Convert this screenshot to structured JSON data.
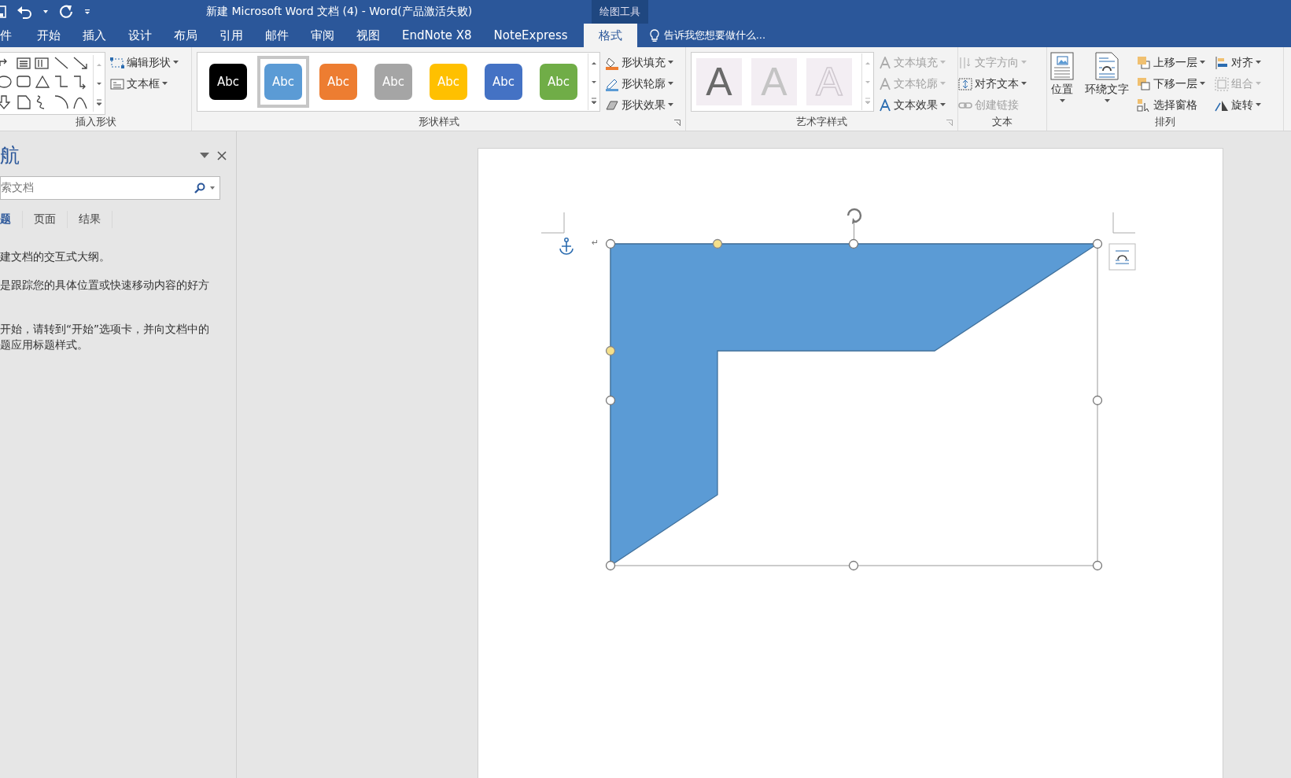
{
  "title_bar": {
    "title": "新建 Microsoft Word 文档 (4) - Word(产品激活失败)",
    "context_label": "绘图工具"
  },
  "tabs": [
    {
      "label": "件",
      "selected": false
    },
    {
      "label": "开始",
      "selected": false
    },
    {
      "label": "插入",
      "selected": false
    },
    {
      "label": "设计",
      "selected": false
    },
    {
      "label": "布局",
      "selected": false
    },
    {
      "label": "引用",
      "selected": false
    },
    {
      "label": "邮件",
      "selected": false
    },
    {
      "label": "审阅",
      "selected": false
    },
    {
      "label": "视图",
      "selected": false
    },
    {
      "label": "EndNote X8",
      "selected": false
    },
    {
      "label": "NoteExpress",
      "selected": false
    },
    {
      "label": "格式",
      "selected": true
    }
  ],
  "tell_me": {
    "placeholder": "告诉我您想要做什么..."
  },
  "ribbon": {
    "insert_shapes": {
      "label": "插入形状",
      "commands": [
        {
          "label": "编辑形状",
          "menu": true
        },
        {
          "label": "文本框",
          "menu": true
        }
      ]
    },
    "shape_styles": {
      "label": "形状样式",
      "presets": [
        {
          "label": "Abc",
          "color": "#000000",
          "selected": false
        },
        {
          "label": "Abc",
          "color": "#5b9bd5",
          "selected": true
        },
        {
          "label": "Abc",
          "color": "#ed7d31",
          "selected": false
        },
        {
          "label": "Abc",
          "color": "#a5a5a5",
          "selected": false
        },
        {
          "label": "Abc",
          "color": "#ffc000",
          "selected": false
        },
        {
          "label": "Abc",
          "color": "#4472c4",
          "selected": false
        },
        {
          "label": "Abc",
          "color": "#70ad47",
          "selected": false
        }
      ],
      "commands": [
        {
          "label": "形状填充",
          "menu": true
        },
        {
          "label": "形状轮廓",
          "menu": true
        },
        {
          "label": "形状效果",
          "menu": true
        }
      ]
    },
    "wordart_styles": {
      "label": "艺术字样式",
      "presets": [
        {
          "label": "A",
          "kind": "dark"
        },
        {
          "label": "A",
          "kind": "light"
        },
        {
          "label": "A",
          "kind": "outline"
        }
      ],
      "commands": [
        {
          "label": "文本填充",
          "menu": true,
          "disabled": true
        },
        {
          "label": "文本轮廓",
          "menu": true,
          "disabled": true
        },
        {
          "label": "文本效果",
          "menu": true,
          "disabled": false
        }
      ]
    },
    "text": {
      "label": "文本",
      "commands": [
        {
          "label": "文字方向",
          "menu": true,
          "disabled": true
        },
        {
          "label": "对齐文本",
          "menu": true,
          "disabled": false
        },
        {
          "label": "创建链接",
          "menu": false,
          "disabled": true
        }
      ]
    },
    "arrange": {
      "label": "排列",
      "large": [
        {
          "label": "位置"
        },
        {
          "label": "环绕文字"
        }
      ],
      "commands": [
        {
          "label": "上移一层",
          "menu": true,
          "disabled": false
        },
        {
          "label": "下移一层",
          "menu": true,
          "disabled": false
        },
        {
          "label": "选择窗格",
          "menu": false,
          "disabled": false
        },
        {
          "label": "对齐",
          "menu": true,
          "disabled": false
        },
        {
          "label": "组合",
          "menu": true,
          "disabled": true
        },
        {
          "label": "旋转",
          "menu": true,
          "disabled": false
        }
      ]
    }
  },
  "navigation": {
    "title": "航",
    "search": {
      "placeholder": "索文档"
    },
    "tabs": [
      {
        "label": "题",
        "selected": true
      },
      {
        "label": "页面",
        "selected": false
      },
      {
        "label": "结果",
        "selected": false
      }
    ],
    "lines": [
      "建文档的交互式大纲。",
      "是跟踪您的具体位置或快速移动内容的好方",
      "开始，请转到“开始”选项卡，并向文档中的",
      "题应用标题样式。"
    ]
  },
  "document": {
    "paragraph_mark": "↵"
  }
}
